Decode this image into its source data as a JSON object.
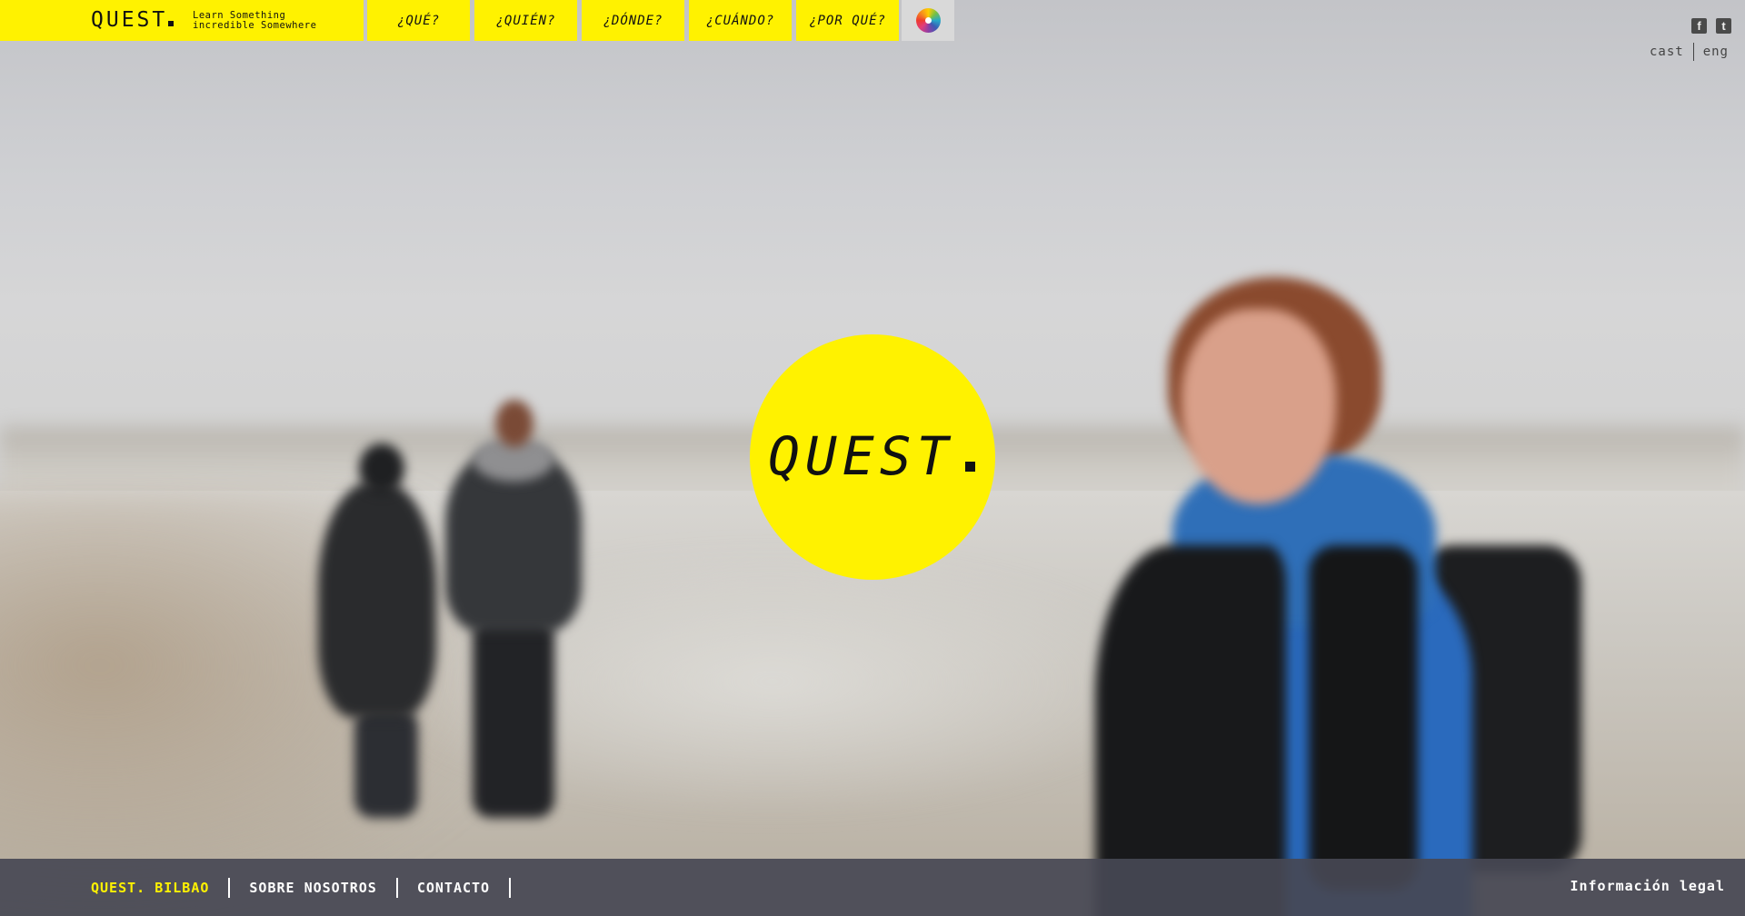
{
  "brand": {
    "logo": "QUEST",
    "tagline_line1": "Learn Something",
    "tagline_line2": "incredible Somewhere",
    "accent_color": "#fff200"
  },
  "nav": {
    "items": [
      {
        "label": "¿QUÉ?"
      },
      {
        "label": "¿QUIÉN?"
      },
      {
        "label": "¿DÓNDE?"
      },
      {
        "label": "¿CUÁNDO?"
      },
      {
        "label": "¿POR QUÉ?"
      }
    ],
    "color_picker_icon": "color-wheel-icon"
  },
  "social": {
    "facebook_glyph": "f",
    "twitter_glyph": "t"
  },
  "language": {
    "options": [
      "cast",
      "eng"
    ]
  },
  "hero": {
    "logo": "QUEST"
  },
  "footer": {
    "links": [
      "QUEST. BILBAO",
      "SOBRE NOSOTROS",
      "CONTACTO"
    ],
    "legal": "Información legal",
    "background_color": "#464854"
  }
}
